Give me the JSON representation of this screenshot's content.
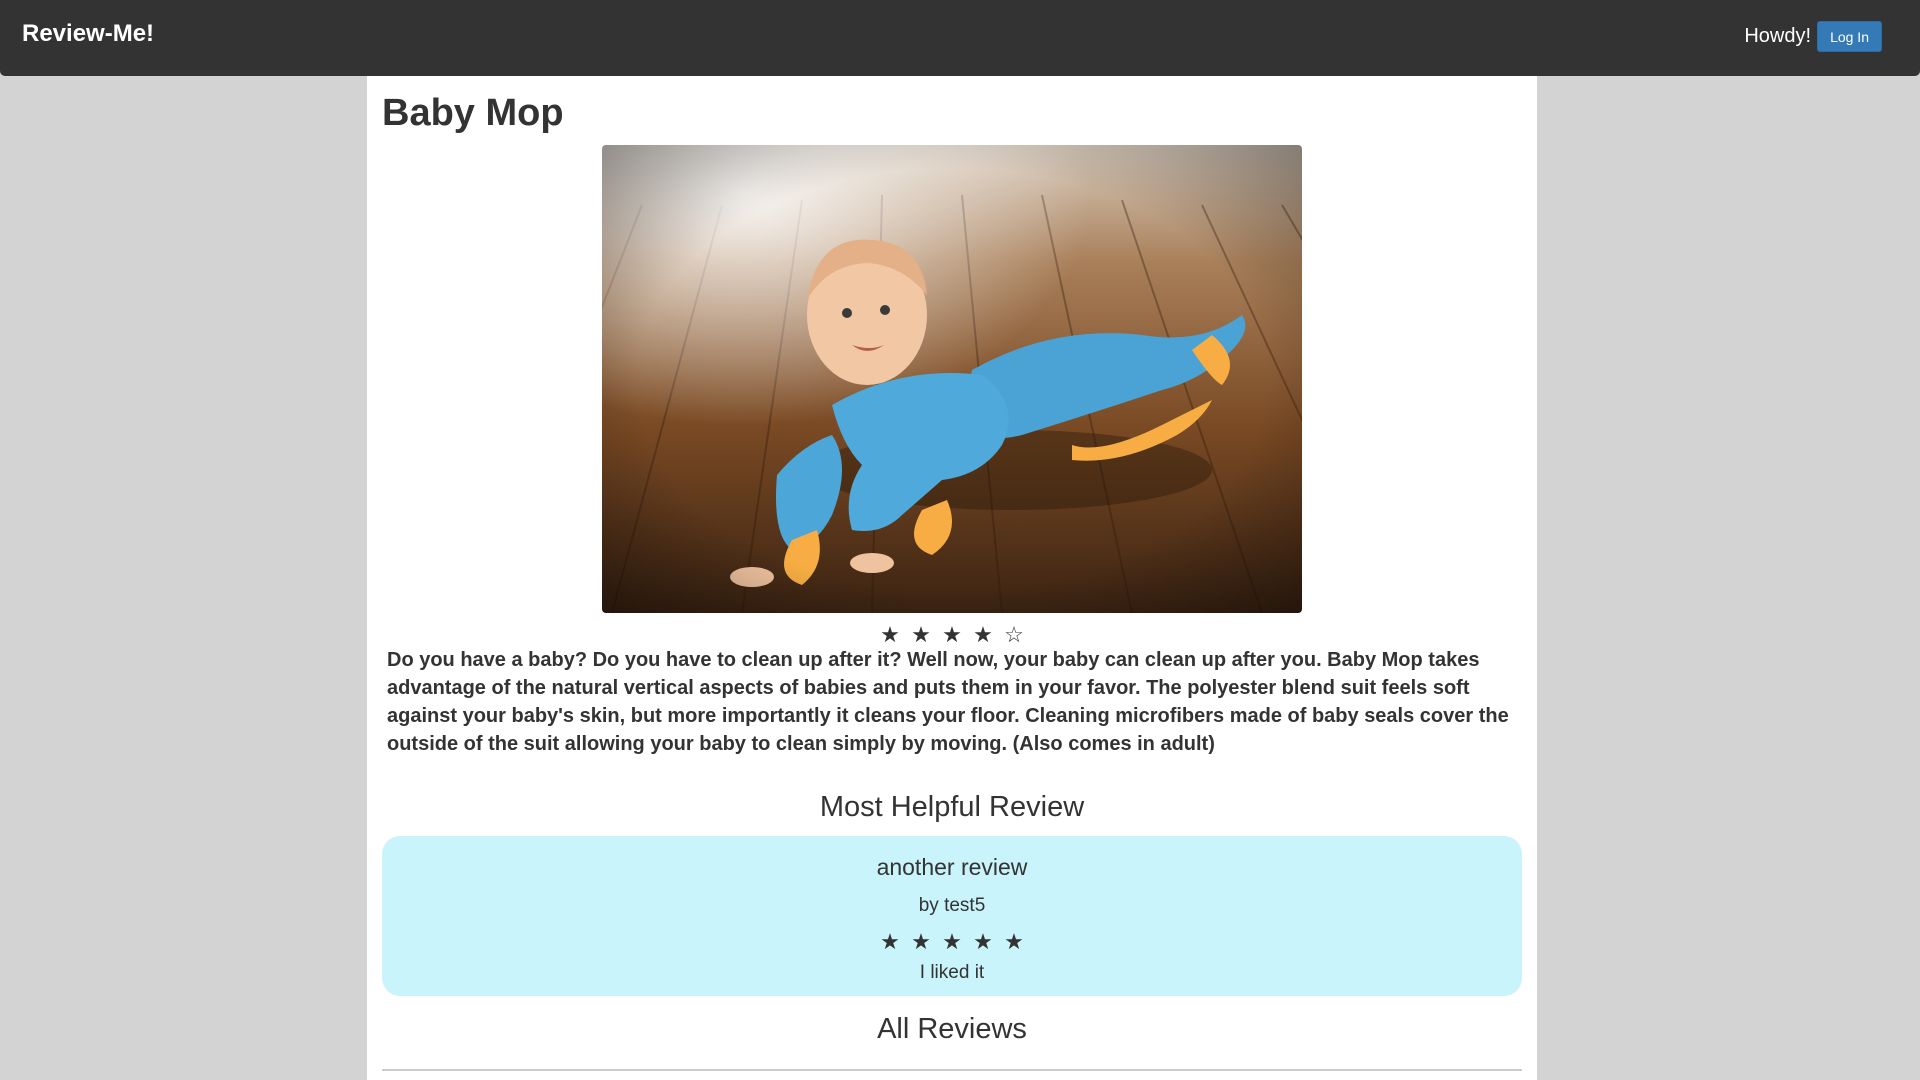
{
  "navbar": {
    "brand": "Review-Me!",
    "greeting": "Howdy!",
    "login_label": "Log In"
  },
  "product": {
    "title": "Baby Mop",
    "image_alt": "Baby in blue mop suit crawling on a wooden floor",
    "rating": 4,
    "rating_max": 5,
    "description": "Do you have a baby? Do you have to clean up after it? Well now, your baby can clean up after you. Baby Mop takes advantage of the natural vertical aspects of babies and puts them in your favor. The polyester blend suit feels soft against your baby's skin, but more importantly it cleans your floor. Cleaning microfibers made of baby seals cover the outside of the suit allowing your baby to clean simply by moving. (Also comes in adult)"
  },
  "most_helpful": {
    "heading": "Most Helpful Review",
    "review_title": "another review",
    "author": "by test5",
    "rating": 5,
    "rating_max": 5,
    "body": "I liked it"
  },
  "all_reviews": {
    "heading": "All Reviews"
  },
  "colors": {
    "navbar": "#333333",
    "page_background": "#d3d3d3",
    "button": "#337ab7",
    "helpful_card": "#c9f4fb"
  }
}
